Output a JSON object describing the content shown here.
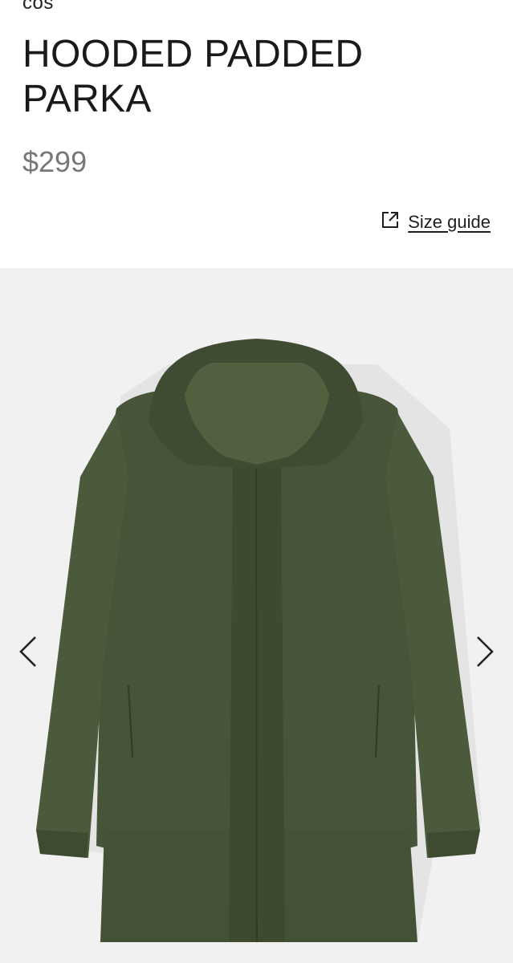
{
  "product": {
    "brand": "COS",
    "title": "HOODED PADDED PARKA",
    "price": "$299"
  },
  "size_guide": {
    "label": "Size guide",
    "icon": "external-link-icon"
  },
  "gallery": {
    "image_subject": "olive green hooded parka",
    "prev_icon": "chevron-left-icon",
    "next_icon": "chevron-right-icon"
  },
  "colors": {
    "coat": "#465437",
    "gallery_bg": "#f1f1f1",
    "price": "#777777",
    "text": "#1f1f1f"
  }
}
